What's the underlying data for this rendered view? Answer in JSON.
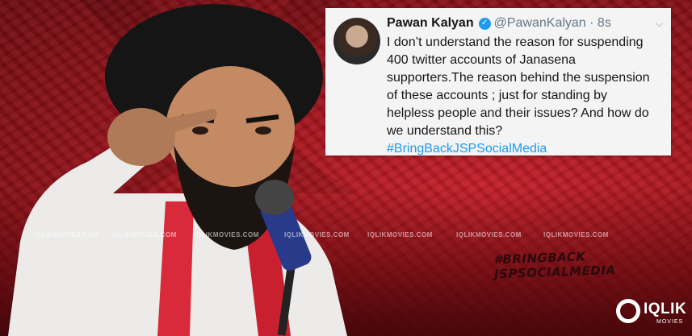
{
  "tweet": {
    "name": "Pawan Kalyan",
    "handle": "@PawanKalyan · 8s",
    "text": "I don’t understand the reason for suspending\n400 twitter accounts of Janasena\nsupporters.The reason behind the suspension\nof these accounts ; just for  standing by\nhelpless people and their issues? And how do\nwe understand this?",
    "hashtag": "#BringBackJSPSocialMedia"
  },
  "sign": {
    "line1": "#BRINGBACK",
    "line2": "JSPSOCIALMEDIA"
  },
  "watermarks": [
    "IQLIKMOVIES.COM",
    "IQLIKMOVIES.COM",
    "IQLIKMOVIES.COM",
    "IQLIKMOVIES.COM",
    "IQLIKMOVIES.COM",
    "IQLIKMOVIES.COM",
    "IQLIKMOVIES.COM"
  ],
  "logo": {
    "text": "IQLIK",
    "sub": "MOVIES"
  },
  "colors": {
    "background_red": "#a3151d",
    "hashtag_blue": "#1d9bf0",
    "verified_blue": "#1d9bf0",
    "scarf_red": "#d82a3a"
  }
}
